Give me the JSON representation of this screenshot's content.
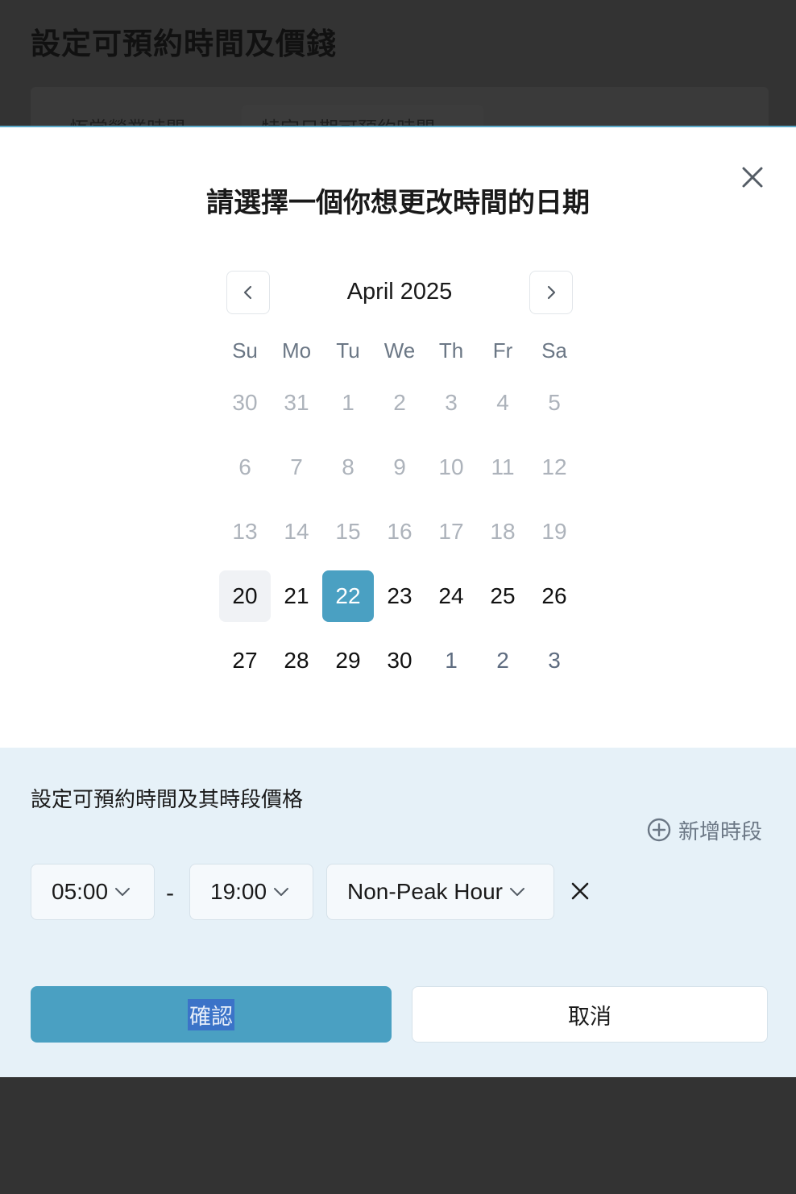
{
  "background": {
    "page_title": "設定可預約時間及價錢",
    "tabs": [
      "恆常營業時間",
      "特定日期可預約時間"
    ]
  },
  "modal": {
    "title": "請選擇一個你想更改時間的日期",
    "close_icon": "close-icon"
  },
  "calendar": {
    "month_label": "April 2025",
    "prev_icon": "chevron-left-icon",
    "next_icon": "chevron-right-icon",
    "weekdays": [
      "Su",
      "Mo",
      "Tu",
      "We",
      "Th",
      "Fr",
      "Sa"
    ],
    "weeks": [
      [
        "30",
        "31",
        "1",
        "2",
        "3",
        "4",
        "5"
      ],
      [
        "6",
        "7",
        "8",
        "9",
        "10",
        "11",
        "12"
      ],
      [
        "13",
        "14",
        "15",
        "16",
        "17",
        "18",
        "19"
      ],
      [
        "20",
        "21",
        "22",
        "23",
        "24",
        "25",
        "26"
      ],
      [
        "27",
        "28",
        "29",
        "30",
        "1",
        "2",
        "3"
      ]
    ],
    "today": "20",
    "selected": "22"
  },
  "slots": {
    "title": "設定可預約時間及其時段價格",
    "add_label": "新增時段",
    "start_time": "05:00",
    "separator": "-",
    "end_time": "19:00",
    "price_type": "Non-Peak Hour"
  },
  "actions": {
    "confirm_label": "確認",
    "cancel_label": "取消"
  },
  "colors": {
    "accent": "#4aa0c2",
    "panel_bg": "#e6f1f8",
    "overlay": "#333333"
  }
}
